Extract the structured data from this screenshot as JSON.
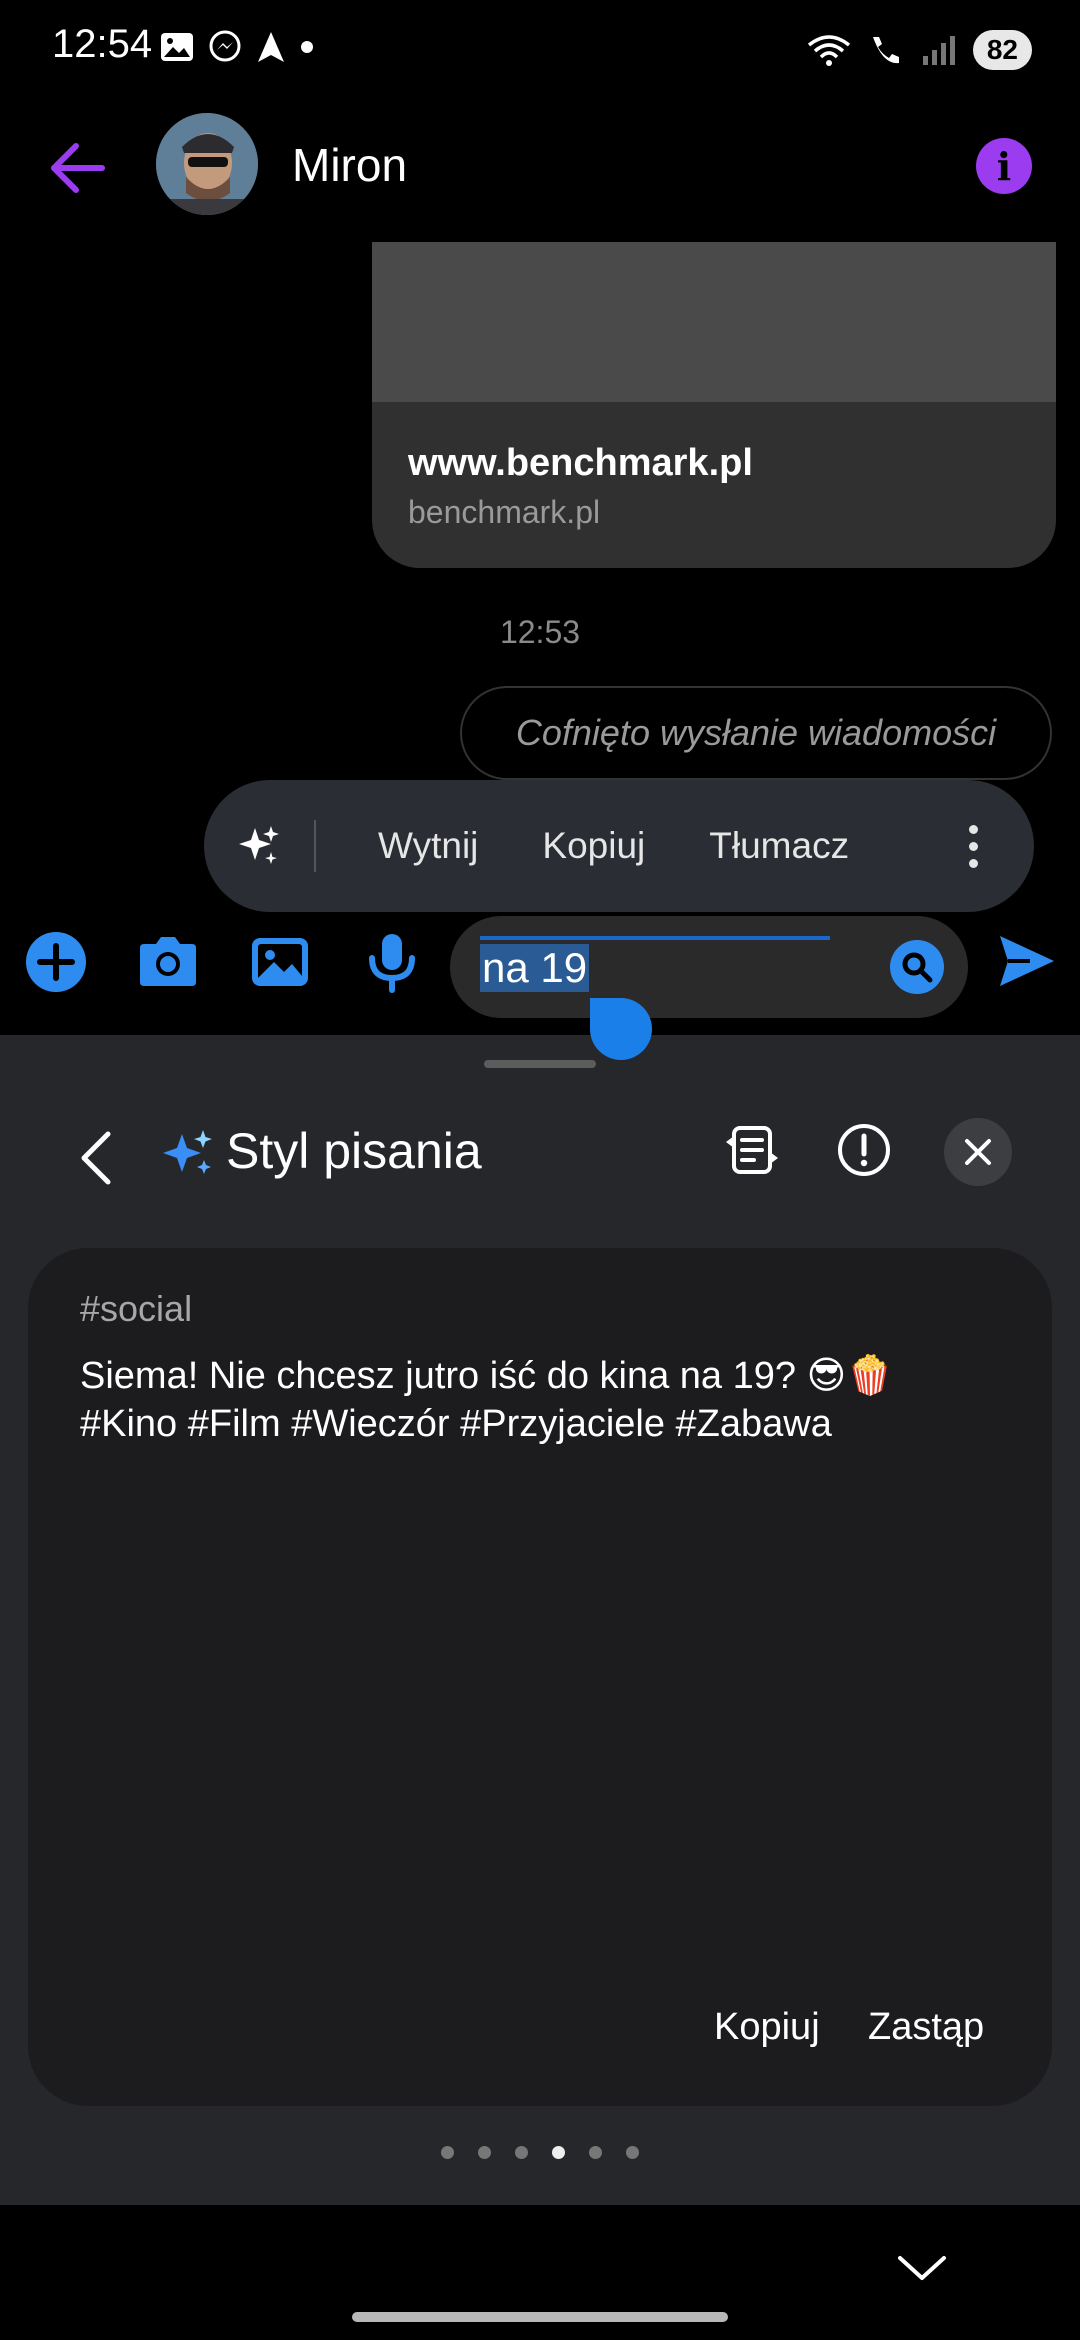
{
  "status_bar": {
    "time": "12:54",
    "battery": "82",
    "left_icons": [
      "gallery-icon",
      "messenger-icon",
      "navigation-icon",
      "dot-icon"
    ],
    "right_icons": [
      "wifi-icon",
      "wifi-call-icon",
      "signal-icon"
    ]
  },
  "header": {
    "contact_name": "Miron",
    "accent_color": "#9b3cf0"
  },
  "conversation": {
    "link_card": {
      "title": "www.benchmark.pl",
      "domain": "benchmark.pl"
    },
    "timestamp": "12:53",
    "unsent_message": "Cofnięto wysłanie wiadomości"
  },
  "context_menu": {
    "items": [
      "Wytnij",
      "Kopiuj",
      "Tłumacz"
    ]
  },
  "composer": {
    "input_value": "na 19",
    "accent_color": "#2e8cf0"
  },
  "writing_style": {
    "title": "Styl pisania",
    "tag": "#social",
    "suggestion_line1": "Siema! Nie chcesz jutro iść do kina na 19? 😎🍿",
    "suggestion_line2": "#Kino #Film #Wieczór #Przyjaciele #Zabawa",
    "copy_label": "Kopiuj",
    "replace_label": "Zastąp",
    "page_count": 6,
    "active_page": 4
  }
}
